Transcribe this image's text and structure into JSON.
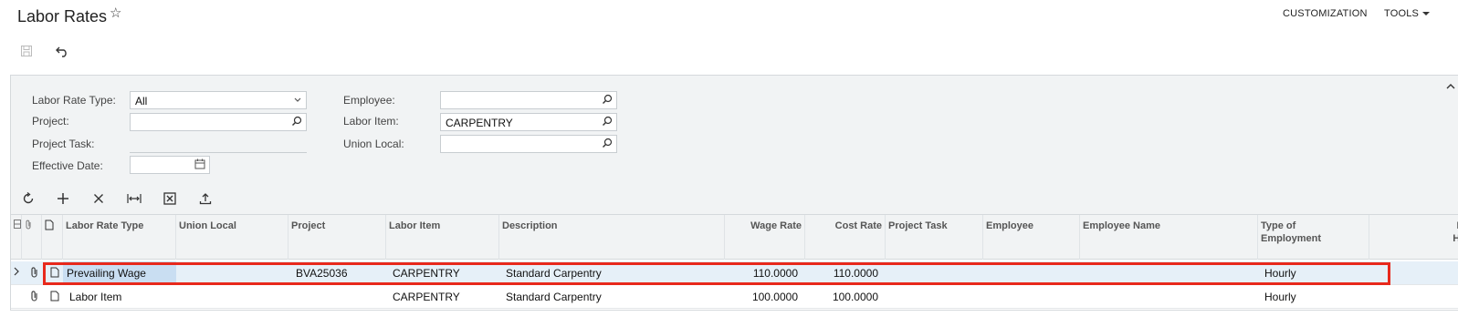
{
  "header": {
    "title": "Labor Rates",
    "menu": {
      "customization": "CUSTOMIZATION",
      "tools": "TOOLS"
    }
  },
  "filters": {
    "labor_rate_type_label": "Labor Rate Type:",
    "labor_rate_type_value": "All",
    "project_label": "Project:",
    "project_value": "",
    "project_task_label": "Project Task:",
    "effective_date_label": "Effective Date:",
    "effective_date_value": "",
    "employee_label": "Employee:",
    "employee_value": "",
    "labor_item_label": "Labor Item:",
    "labor_item_value": "CARPENTRY",
    "union_local_label": "Union Local:",
    "union_local_value": ""
  },
  "grid": {
    "columns": {
      "labor_rate_type": "Labor Rate Type",
      "union_local": "Union Local",
      "project": "Project",
      "labor_item": "Labor Item",
      "description": "Description",
      "wage_rate": "Wage Rate",
      "cost_rate": "Cost Rate",
      "project_task": "Project Task",
      "employee": "Employee",
      "employee_name": "Employee Name",
      "type_of_employment_1": "Type of",
      "type_of_employment_2": "Employment",
      "regular_hours_1": "Regu",
      "regular_hours_2": "Hours",
      "regular_hours_3": "we"
    },
    "rows": [
      {
        "labor_rate_type": "Prevailing Wage",
        "union_local": "",
        "project": "BVA25036",
        "labor_item": "CARPENTRY",
        "description": "Standard Carpentry",
        "wage_rate": "110.0000",
        "cost_rate": "110.0000",
        "project_task": "",
        "employee": "",
        "employee_name": "",
        "type_of_employment": "Hourly"
      },
      {
        "labor_rate_type": "Labor Item",
        "union_local": "",
        "project": "",
        "labor_item": "CARPENTRY",
        "description": "Standard Carpentry",
        "wage_rate": "100.0000",
        "cost_rate": "100.0000",
        "project_task": "",
        "employee": "",
        "employee_name": "",
        "type_of_employment": "Hourly"
      }
    ]
  },
  "colors": {
    "highlight": "#e8291c",
    "selected_row": "#e6f0f8",
    "panel_bg": "#f1f3f4"
  }
}
